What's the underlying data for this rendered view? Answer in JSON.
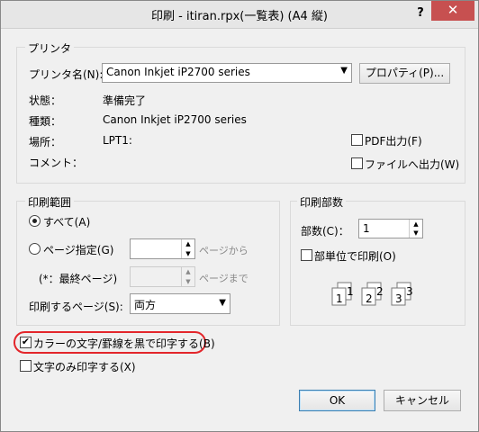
{
  "title": "印刷 - itiran.rpx(一覧表) (A4 縦)",
  "help_label": "?",
  "close_label": "✕",
  "printer": {
    "group_label": "プリンタ",
    "name_label": "プリンタ名(N):",
    "name_value": "Canon Inkjet iP2700 series",
    "properties_button": "プロパティ(P)...",
    "status_label": "状態：",
    "status_value": "準備完了",
    "type_label": "種類：",
    "type_value": "Canon Inkjet iP2700 series",
    "location_label": "場所：",
    "location_value": "LPT1:",
    "comment_label": "コメント：",
    "pdf_output_label": "PDF出力(F)",
    "file_output_label": "ファイルへ出力(W)"
  },
  "range": {
    "group_label": "印刷範囲",
    "all_label": "すべて(A)",
    "pages_label": "ページ指定(G)",
    "from_suffix": "ページから",
    "last_page_note": "(*：最終ページ)",
    "to_suffix": "ページまで",
    "print_pages_label": "印刷するページ(S):",
    "print_pages_value": "両方"
  },
  "copies": {
    "group_label": "印刷部数",
    "count_label": "部数(C)：",
    "count_value": "1",
    "collate_label": "部単位で印刷(O)",
    "collate_icons": [
      "1",
      "1",
      "2",
      "2",
      "3",
      "3"
    ]
  },
  "options": {
    "black_text_label": "カラーの文字/罫線を黒で印字する(B)",
    "black_text_checked": true,
    "text_only_label": "文字のみ印字する(X)",
    "text_only_checked": false
  },
  "buttons": {
    "ok": "OK",
    "cancel": "キャンセル"
  },
  "colors": {
    "close_button": "#c75050",
    "highlight": "#e3262b"
  }
}
